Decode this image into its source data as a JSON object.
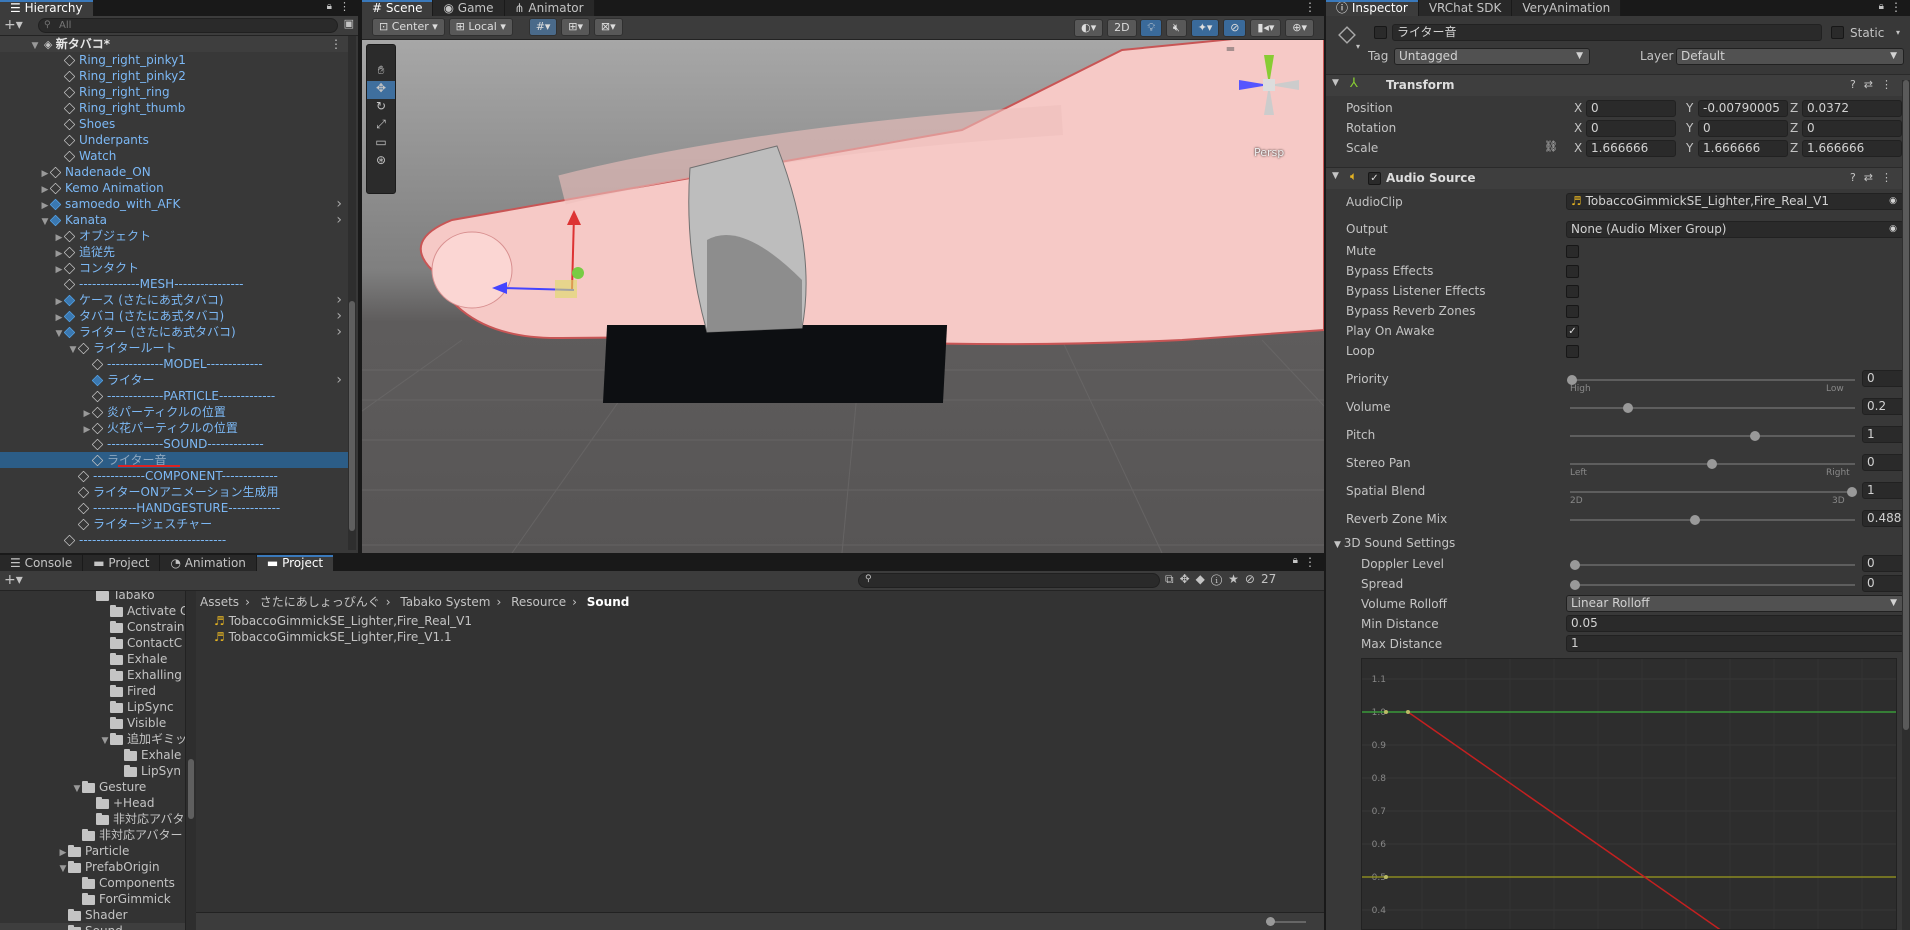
{
  "hierarchy": {
    "tab": "Hierarchy",
    "search_placeholder": "All",
    "scene": "新タバコ*",
    "items": [
      {
        "label": "Ring_right_pinky1",
        "indent": 4,
        "arrow": "",
        "icon": "go",
        "blue": true
      },
      {
        "label": "Ring_right_pinky2",
        "indent": 4,
        "arrow": "",
        "icon": "go",
        "blue": true
      },
      {
        "label": "Ring_right_ring",
        "indent": 4,
        "arrow": "",
        "icon": "go",
        "blue": true
      },
      {
        "label": "Ring_right_thumb",
        "indent": 4,
        "arrow": "",
        "icon": "go",
        "blue": true
      },
      {
        "label": "Shoes",
        "indent": 4,
        "arrow": "",
        "icon": "go",
        "blue": true
      },
      {
        "label": "Underpants",
        "indent": 4,
        "arrow": "",
        "icon": "go",
        "blue": true
      },
      {
        "label": "Watch",
        "indent": 4,
        "arrow": "",
        "icon": "go",
        "blue": true
      },
      {
        "label": "Nadenade_ON",
        "indent": 3,
        "arrow": "▶",
        "icon": "go",
        "blue": true
      },
      {
        "label": "Kemo Animation",
        "indent": 3,
        "arrow": "▶",
        "icon": "go",
        "blue": true
      },
      {
        "label": "samoedo_with_AFK",
        "indent": 3,
        "arrow": "▶",
        "icon": "prefab",
        "blue": true,
        "more": true
      },
      {
        "label": "Kanata",
        "indent": 3,
        "arrow": "▼",
        "icon": "prefab",
        "blue": true,
        "more": true
      },
      {
        "label": "オブジェクト",
        "indent": 4,
        "arrow": "▶",
        "icon": "go",
        "blue": true
      },
      {
        "label": "追従先",
        "indent": 4,
        "arrow": "▶",
        "icon": "go",
        "blue": true
      },
      {
        "label": "コンタクト",
        "indent": 4,
        "arrow": "▶",
        "icon": "go",
        "blue": true
      },
      {
        "label": "--------------MESH----------------",
        "indent": 4,
        "arrow": "",
        "icon": "go",
        "blue": true
      },
      {
        "label": "ケース (さたにあ式タバコ)",
        "indent": 4,
        "arrow": "▶",
        "icon": "prefab",
        "blue": true,
        "more": true
      },
      {
        "label": "タバコ (さたにあ式タバコ)",
        "indent": 4,
        "arrow": "▶",
        "icon": "prefab",
        "blue": true,
        "more": true
      },
      {
        "label": "ライター (さたにあ式タバコ)",
        "indent": 4,
        "arrow": "▼",
        "icon": "prefab",
        "blue": true,
        "more": true
      },
      {
        "label": "ライタールート",
        "indent": 5,
        "arrow": "▼",
        "icon": "go",
        "blue": true
      },
      {
        "label": "-------------MODEL-------------",
        "indent": 6,
        "arrow": "",
        "icon": "go",
        "blue": true
      },
      {
        "label": "ライター",
        "indent": 6,
        "arrow": "",
        "icon": "prefab",
        "blue": true,
        "more": true
      },
      {
        "label": "-------------PARTICLE-------------",
        "indent": 6,
        "arrow": "",
        "icon": "go",
        "blue": true
      },
      {
        "label": "炎パーティクルの位置",
        "indent": 6,
        "arrow": "▶",
        "icon": "go",
        "blue": true
      },
      {
        "label": "火花パーティクルの位置",
        "indent": 6,
        "arrow": "▶",
        "icon": "go",
        "blue": true
      },
      {
        "label": "-------------SOUND-------------",
        "indent": 6,
        "arrow": "",
        "icon": "go",
        "blue": true
      },
      {
        "label": "ライター音",
        "indent": 6,
        "arrow": "",
        "icon": "go",
        "blue": false,
        "selected": true
      },
      {
        "label": "------------COMPONENT-------------",
        "indent": 5,
        "arrow": "",
        "icon": "go",
        "blue": true
      },
      {
        "label": "ライターONアニメーション生成用",
        "indent": 5,
        "arrow": "",
        "icon": "go",
        "blue": true
      },
      {
        "label": "----------HANDGESTURE------------",
        "indent": 5,
        "arrow": "",
        "icon": "go",
        "blue": true
      },
      {
        "label": "ライタージェスチャー",
        "indent": 5,
        "arrow": "",
        "icon": "go",
        "blue": true
      },
      {
        "label": "----------------------------------",
        "indent": 4,
        "arrow": "",
        "icon": "go",
        "blue": true
      }
    ]
  },
  "scene": {
    "tabs": [
      "Scene",
      "Game",
      "Animator"
    ],
    "pivot": "Center",
    "space": "Local",
    "btn2d": "2D",
    "persp": "Persp"
  },
  "bottom": {
    "tabs": [
      "Console",
      "Project",
      "Animation",
      "Project"
    ],
    "count": "27",
    "breadcrumb": [
      "Assets",
      "さたにあしょっぴんぐ",
      "Tabako System",
      "Resource",
      "Sound"
    ],
    "files": [
      "TobaccoGimmickSE_Lighter,Fire_Real_V1",
      "TobaccoGimmickSE_Lighter,Fire_V1.1"
    ],
    "tree": [
      {
        "label": "Tabako",
        "indent": 3,
        "arrow": ""
      },
      {
        "label": "Activate C",
        "indent": 4,
        "arrow": ""
      },
      {
        "label": "Constrain",
        "indent": 4,
        "arrow": ""
      },
      {
        "label": "ContactC",
        "indent": 4,
        "arrow": ""
      },
      {
        "label": "Exhale",
        "indent": 4,
        "arrow": ""
      },
      {
        "label": "Exhalling",
        "indent": 4,
        "arrow": ""
      },
      {
        "label": "Fired",
        "indent": 4,
        "arrow": ""
      },
      {
        "label": "LipSync",
        "indent": 4,
        "arrow": ""
      },
      {
        "label": "Visible",
        "indent": 4,
        "arrow": ""
      },
      {
        "label": "追加ギミック",
        "indent": 4,
        "arrow": "▼"
      },
      {
        "label": "Exhale",
        "indent": 5,
        "arrow": ""
      },
      {
        "label": "LipSyn",
        "indent": 5,
        "arrow": ""
      },
      {
        "label": "Gesture",
        "indent": 2,
        "arrow": "▼"
      },
      {
        "label": "+Head",
        "indent": 3,
        "arrow": ""
      },
      {
        "label": "非対応アバター",
        "indent": 3,
        "arrow": ""
      },
      {
        "label": "非対応アバター",
        "indent": 2,
        "arrow": ""
      },
      {
        "label": "Particle",
        "indent": 1,
        "arrow": "▶"
      },
      {
        "label": "PrefabOrigin",
        "indent": 1,
        "arrow": "▼"
      },
      {
        "label": "Components",
        "indent": 2,
        "arrow": ""
      },
      {
        "label": "ForGimmick",
        "indent": 2,
        "arrow": ""
      },
      {
        "label": "Shader",
        "indent": 1,
        "arrow": ""
      },
      {
        "label": "Sound",
        "indent": 1,
        "arrow": ""
      }
    ]
  },
  "inspector": {
    "tabs": [
      "Inspector",
      "VRChat SDK",
      "VeryAnimation"
    ],
    "object_name": "ライター音",
    "static_label": "Static",
    "tag_label": "Tag",
    "tag": "Untagged",
    "layer_label": "Layer",
    "layer": "Default",
    "transform": {
      "title": "Transform",
      "position_label": "Position",
      "rotation_label": "Rotation",
      "scale_label": "Scale",
      "position": [
        "0",
        "-0.00790005",
        "0.0372"
      ],
      "rotation": [
        "0",
        "0",
        "0"
      ],
      "scale": [
        "1.666666",
        "1.666666",
        "1.666666"
      ]
    },
    "audio": {
      "title": "Audio Source",
      "audioclip_label": "AudioClip",
      "audioclip": "TobaccoGimmickSE_Lighter,Fire_Real_V1",
      "output_label": "Output",
      "output": "None (Audio Mixer Group)",
      "toggles": [
        {
          "label": "Mute",
          "checked": false
        },
        {
          "label": "Bypass Effects",
          "checked": false
        },
        {
          "label": "Bypass Listener Effects",
          "checked": false
        },
        {
          "label": "Bypass Reverb Zones",
          "checked": false
        },
        {
          "label": "Play On Awake",
          "checked": true
        },
        {
          "label": "Loop",
          "checked": false
        }
      ],
      "sliders": [
        {
          "label": "Priority",
          "value": "0",
          "frac": 0,
          "left": "High",
          "right": "Low"
        },
        {
          "label": "Volume",
          "value": "0.2",
          "frac": 0.2,
          "left": "",
          "right": ""
        },
        {
          "label": "Pitch",
          "value": "1",
          "frac": 0.655,
          "left": "",
          "right": ""
        },
        {
          "label": "Stereo Pan",
          "value": "0",
          "frac": 0.5,
          "left": "Left",
          "right": "Right"
        },
        {
          "label": "Spatial Blend",
          "value": "1",
          "frac": 1,
          "left": "2D",
          "right": "3D"
        },
        {
          "label": "Reverb Zone Mix",
          "value": "0.488",
          "frac": 0.44,
          "left": "",
          "right": ""
        }
      ],
      "sound3d": {
        "title": "3D Sound Settings",
        "doppler_label": "Doppler Level",
        "doppler": "0",
        "spread_label": "Spread",
        "spread": "0",
        "rolloff_label": "Volume Rolloff",
        "rolloff": "Linear Rolloff",
        "min_label": "Min Distance",
        "min": "0.05",
        "max_label": "Max Distance",
        "max": "1"
      },
      "graph_ticks": [
        "1.1",
        "1.0",
        "0.9",
        "0.8",
        "0.7",
        "0.6",
        "0.5",
        "0.4"
      ]
    }
  },
  "colors": {
    "selected": "#2c5d87",
    "accent": "#3a79bb",
    "prefab_blue": "#7cb8f5"
  }
}
